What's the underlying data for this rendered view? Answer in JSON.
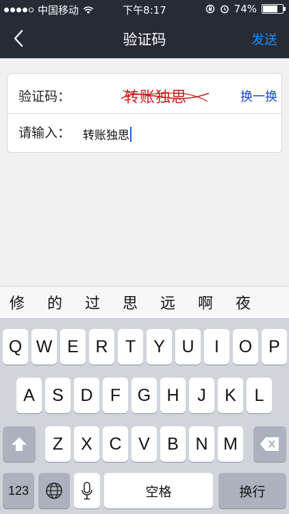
{
  "status_bar": {
    "carrier": "中国移动",
    "time": "下午8:17",
    "battery_percent": "74%",
    "battery_level": 0.74,
    "signal_icon": "signal-dots-icon",
    "wifi_icon": "wifi-icon",
    "rotation_lock_icon": "rotation-lock-icon",
    "alarm_icon": "alarm-icon"
  },
  "nav": {
    "back_icon": "chevron-left-icon",
    "title": "验证码",
    "send_label": "发送"
  },
  "form": {
    "captcha_label": "验证码：",
    "captcha_image_text": "转账独思",
    "refresh_label": "换一换",
    "input_label": "请输入：",
    "input_value": "转账独思"
  },
  "candidates": [
    "修",
    "的",
    "过",
    "思",
    "远",
    "啊",
    "夜"
  ],
  "keyboard": {
    "row1": [
      "Q",
      "W",
      "E",
      "R",
      "T",
      "Y",
      "U",
      "I",
      "O",
      "P"
    ],
    "row2": [
      "A",
      "S",
      "D",
      "F",
      "G",
      "H",
      "J",
      "K",
      "L"
    ],
    "row3": [
      "Z",
      "X",
      "C",
      "V",
      "B",
      "N",
      "M"
    ],
    "numbers_key": "123",
    "space_key": "空格",
    "return_key": "换行",
    "shift_icon": "shift-arrow-icon",
    "delete_icon": "backspace-icon",
    "globe_icon": "globe-icon",
    "mic_icon": "microphone-icon"
  },
  "colors": {
    "nav_background": "#262b36",
    "send_accent": "#1f8cf0",
    "refresh_link": "#1442d8",
    "captcha_red": "#c81e1e",
    "caret": "#1e5bff"
  }
}
